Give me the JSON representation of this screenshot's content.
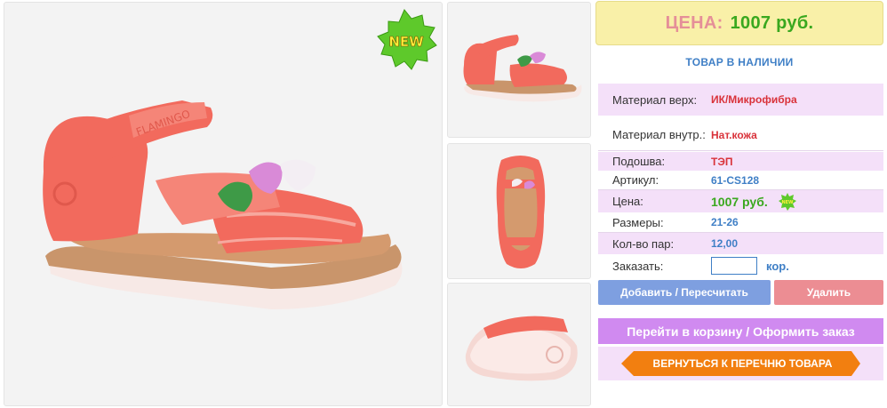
{
  "main_image": {
    "alt": "coral-sandal-main",
    "badge": "NEW",
    "sole_text": "FLAMINGO"
  },
  "price": {
    "label": "ЦЕНА:",
    "value": "1007 руб."
  },
  "stock": "ТОВАР В НАЛИЧИИ",
  "specs": [
    {
      "label": "Материал верх:",
      "value": "ИК/Микрофибра"
    },
    {
      "label": "Материал внутр.:",
      "value": "Нат.кожа"
    },
    {
      "label": "Подошва:",
      "value": "ТЭП"
    },
    {
      "label": "Артикул:",
      "value": "61-CS128"
    },
    {
      "label": "Цена:",
      "value": "1007 руб."
    },
    {
      "label": "Размеры:",
      "value": "21-26"
    },
    {
      "label": "Кол-во пар:",
      "value": "12,00"
    }
  ],
  "order": {
    "label": "Заказать:",
    "value": "",
    "unit": "кор.",
    "mini_badge": "NEW"
  },
  "buttons": {
    "add": "Добавить / Пересчитать",
    "delete": "Удалить",
    "cart": "Перейти в корзину / Оформить заказ",
    "back": "ВЕРНУТЬСЯ К ПЕРЕЧНЮ ТОВАРА"
  },
  "colors": {
    "price_label": "#e58f98",
    "price_value": "#3aa81f",
    "accent_blue": "#3f7fc6",
    "accent_red": "#d9323a",
    "sandal": "#f26a5d",
    "back_button": "#f27f10",
    "cart_button": "#d08af0"
  }
}
